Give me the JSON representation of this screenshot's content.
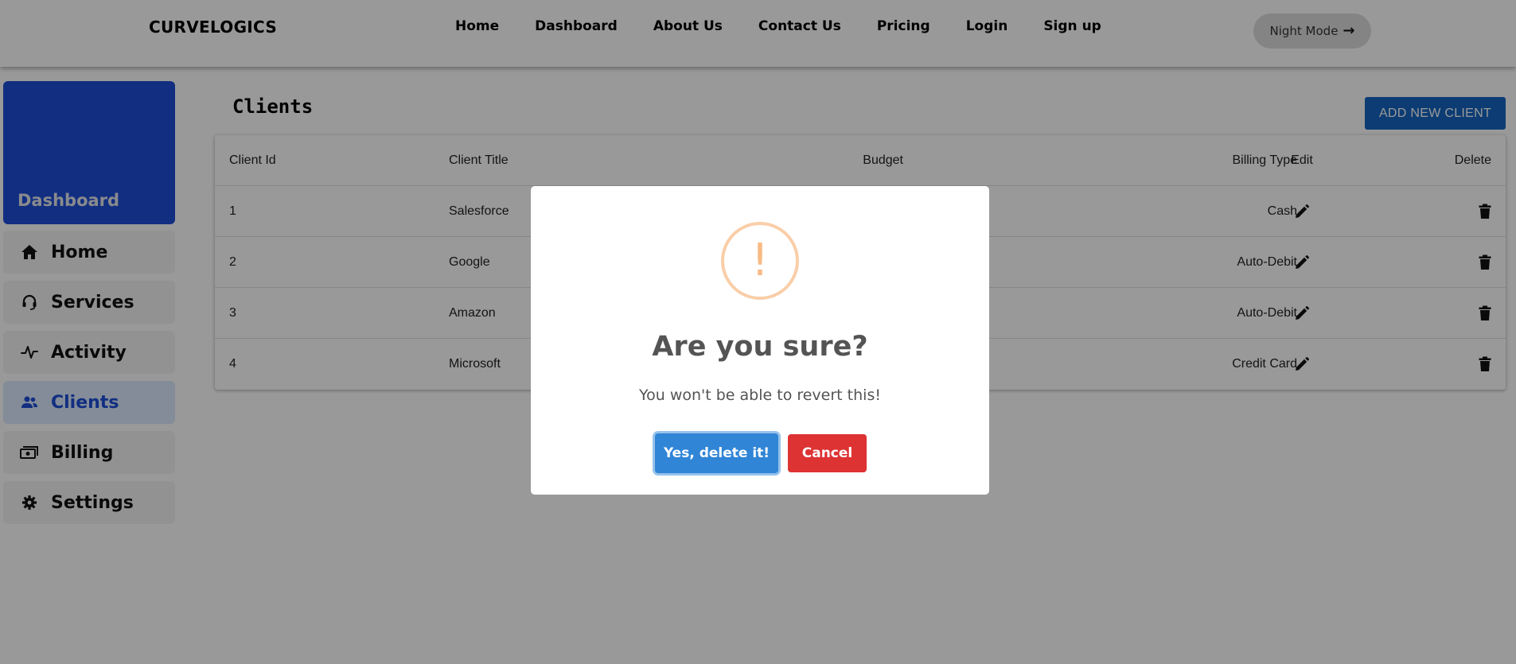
{
  "navbar": {
    "brand": "CURVELOGICS",
    "links": [
      "Home",
      "Dashboard",
      "About Us",
      "Contact Us",
      "Pricing",
      "Login",
      "Sign up"
    ],
    "night_mode_label": "Night Mode",
    "night_mode_icon": "arrow-right-icon"
  },
  "sidebar": {
    "header_title": "Dashboard",
    "items": [
      {
        "label": "Home",
        "icon": "home-icon"
      },
      {
        "label": "Services",
        "icon": "headset-icon"
      },
      {
        "label": "Activity",
        "icon": "activity-icon"
      },
      {
        "label": "Clients",
        "icon": "users-icon",
        "active": true
      },
      {
        "label": "Billing",
        "icon": "money-icon"
      },
      {
        "label": "Settings",
        "icon": "gear-icon"
      }
    ]
  },
  "main": {
    "title": "Clients",
    "add_button_label": "ADD NEW CLIENT",
    "table": {
      "headers": {
        "client_id": "Client Id",
        "client_title": "Client Title",
        "budget": "Budget",
        "billing_type": "Billing Type",
        "edit": "Edit",
        "delete": "Delete"
      },
      "rows": [
        {
          "client_id": "1",
          "client_title": "Salesforce",
          "billing_type": "Cash"
        },
        {
          "client_id": "2",
          "client_title": "Google",
          "billing_type": "Auto-Debit"
        },
        {
          "client_id": "3",
          "client_title": "Amazon",
          "billing_type": "Auto-Debit"
        },
        {
          "client_id": "4",
          "client_title": "Microsoft",
          "billing_type": "Credit Card"
        }
      ]
    }
  },
  "modal": {
    "icon": "warning-icon",
    "icon_glyph": "!",
    "title": "Are you sure?",
    "text": "You won't be able to revert this!",
    "confirm_label": "Yes, delete it!",
    "cancel_label": "Cancel"
  },
  "colors": {
    "accent": "#1d4ed8",
    "add_button": "#1565c0",
    "confirm": "#3085d6",
    "cancel": "#dd3333",
    "warning": "#f8bb86"
  }
}
